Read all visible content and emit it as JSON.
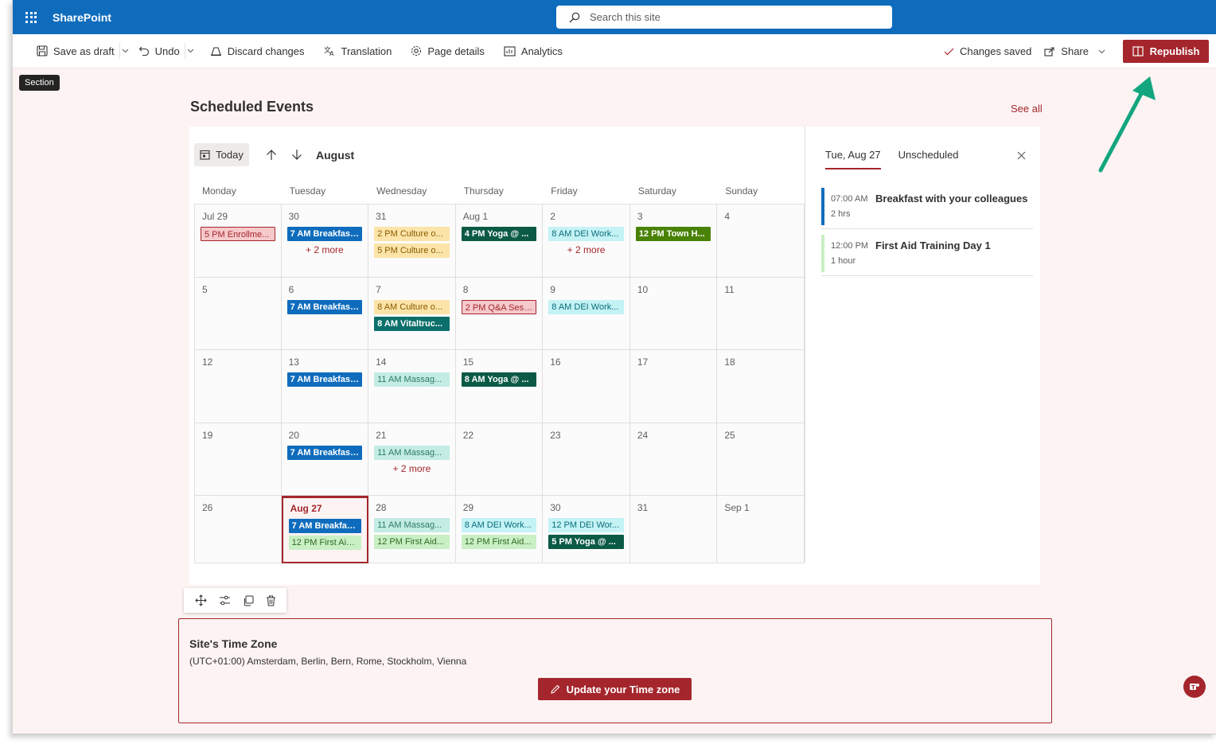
{
  "app": {
    "name": "SharePoint"
  },
  "search": {
    "placeholder": "Search this site"
  },
  "toolbar": {
    "save_draft": "Save as draft",
    "undo": "Undo",
    "discard": "Discard changes",
    "translation": "Translation",
    "page_details": "Page details",
    "analytics": "Analytics",
    "changes_saved": "Changes saved",
    "share": "Share",
    "republish": "Republish"
  },
  "section_tooltip": "Section",
  "webpart": {
    "title": "Scheduled Events",
    "see_all": "See all"
  },
  "calendar": {
    "today_label": "Today",
    "month": "August",
    "weekdays": [
      "Monday",
      "Tuesday",
      "Wednesday",
      "Thursday",
      "Friday",
      "Saturday",
      "Sunday"
    ],
    "weeks": [
      [
        {
          "date": "Jul 29",
          "events": [
            {
              "label": "5 PM Enrollme...",
              "style": "red"
            }
          ]
        },
        {
          "date": "30",
          "events": [
            {
              "label": "7 AM Breakfast...",
              "style": "blue"
            }
          ],
          "more": "+ 2 more"
        },
        {
          "date": "31",
          "events": [
            {
              "label": "2 PM Culture o...",
              "style": "yellow"
            },
            {
              "label": "5 PM Culture o...",
              "style": "yellow"
            }
          ]
        },
        {
          "date": "Aug 1",
          "events": [
            {
              "label": "4 PM Yoga @ ...",
              "style": "darkgreen"
            }
          ]
        },
        {
          "date": "2",
          "events": [
            {
              "label": "8 AM DEI Work...",
              "style": "cyan"
            }
          ],
          "more": "+ 2 more"
        },
        {
          "date": "3",
          "events": [
            {
              "label": "12 PM Town H...",
              "style": "olive"
            }
          ]
        },
        {
          "date": "4",
          "events": []
        }
      ],
      [
        {
          "date": "5",
          "events": []
        },
        {
          "date": "6",
          "events": [
            {
              "label": "7 AM Breakfast...",
              "style": "blue"
            }
          ]
        },
        {
          "date": "7",
          "events": [
            {
              "label": "8 AM Culture o...",
              "style": "yellow"
            },
            {
              "label": "8 AM Vitaltruc...",
              "style": "teal"
            }
          ]
        },
        {
          "date": "8",
          "events": [
            {
              "label": "2 PM Q&A Sess...",
              "style": "red"
            }
          ]
        },
        {
          "date": "9",
          "events": [
            {
              "label": "8 AM DEI Work...",
              "style": "cyan"
            }
          ]
        },
        {
          "date": "10",
          "events": []
        },
        {
          "date": "11",
          "events": []
        }
      ],
      [
        {
          "date": "12",
          "events": []
        },
        {
          "date": "13",
          "events": [
            {
              "label": "7 AM Breakfast...",
              "style": "blue"
            }
          ]
        },
        {
          "date": "14",
          "events": [
            {
              "label": "11 AM Massag...",
              "style": "mint"
            }
          ]
        },
        {
          "date": "15",
          "events": [
            {
              "label": "8 AM Yoga @ ...",
              "style": "darkgreen"
            }
          ]
        },
        {
          "date": "16",
          "events": []
        },
        {
          "date": "17",
          "events": []
        },
        {
          "date": "18",
          "events": []
        }
      ],
      [
        {
          "date": "19",
          "events": []
        },
        {
          "date": "20",
          "events": [
            {
              "label": "7 AM Breakfast...",
              "style": "blue"
            }
          ]
        },
        {
          "date": "21",
          "events": [
            {
              "label": "11 AM Massag...",
              "style": "mint"
            }
          ],
          "more": "+ 2 more"
        },
        {
          "date": "22",
          "events": []
        },
        {
          "date": "23",
          "events": []
        },
        {
          "date": "24",
          "events": []
        },
        {
          "date": "25",
          "events": []
        }
      ],
      [
        {
          "date": "26",
          "events": []
        },
        {
          "date": "Aug 27",
          "today": true,
          "events": [
            {
              "label": "7 AM Breakfast...",
              "style": "blue"
            },
            {
              "label": "12 PM First Aid...",
              "style": "lightgreen"
            }
          ]
        },
        {
          "date": "28",
          "events": [
            {
              "label": "11 AM Massag...",
              "style": "mint"
            },
            {
              "label": "12 PM First Aid...",
              "style": "lightgreen"
            }
          ]
        },
        {
          "date": "29",
          "events": [
            {
              "label": "8 AM DEI Work...",
              "style": "cyan"
            },
            {
              "label": "12 PM First Aid...",
              "style": "lightgreen"
            }
          ]
        },
        {
          "date": "30",
          "events": [
            {
              "label": "12 PM DEI Wor...",
              "style": "cyan"
            },
            {
              "label": "5 PM Yoga @ ...",
              "style": "darkgreen"
            }
          ]
        },
        {
          "date": "31",
          "events": []
        },
        {
          "date": "Sep 1",
          "events": []
        }
      ]
    ],
    "styles": {
      "blue": {
        "bg": "#0f6cbd",
        "fg": "#ffffff",
        "bold": true
      },
      "red": {
        "bg": "#f6c9cb",
        "fg": "#a4262c",
        "border": "#a4262c"
      },
      "yellow": {
        "bg": "#fce4a8",
        "fg": "#8a5a00"
      },
      "darkgreen": {
        "bg": "#0b5a45",
        "fg": "#ffffff",
        "bold": true
      },
      "cyan": {
        "bg": "#c4f2f5",
        "fg": "#0a6f7a"
      },
      "olive": {
        "bg": "#498205",
        "fg": "#ffffff",
        "bold": true
      },
      "teal": {
        "bg": "#0c6f6b",
        "fg": "#ffffff",
        "bold": true
      },
      "mint": {
        "bg": "#c3ece4",
        "fg": "#2c7a6b"
      },
      "lightgreen": {
        "bg": "#c9efc4",
        "fg": "#2f6b23"
      }
    }
  },
  "agenda": {
    "tabs": [
      "Tue, Aug 27",
      "Unscheduled"
    ],
    "items": [
      {
        "time": "07:00 AM",
        "title": "Breakfast with your colleagues",
        "duration": "2 hrs",
        "color": "#0f6cbd"
      },
      {
        "time": "12:00 PM",
        "title": "First Aid Training Day 1",
        "duration": "1 hour",
        "color": "#c9efc4"
      }
    ]
  },
  "timezone": {
    "title": "Site's Time Zone",
    "value": "(UTC+01:00) Amsterdam, Berlin, Bern, Rome, Stockholm, Vienna",
    "button": "Update your Time zone"
  },
  "colors": {
    "brand": "#0f6cbd",
    "accent": "#a4262c",
    "annotation_arrow": "#12a67e"
  }
}
